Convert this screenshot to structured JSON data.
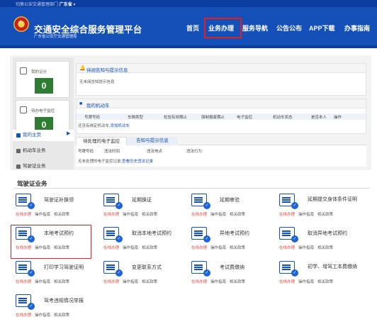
{
  "topbar": {
    "prefix": "切换公安交通管理部门",
    "region": "广东省",
    "arrow": "▾"
  },
  "header": {
    "title": "交通安全综合服务管理平台",
    "subtitle": "广东省公安厅交通管理局"
  },
  "nav": [
    "首页",
    "业务办理",
    "服务导航",
    "公告公布",
    "APP下载",
    "办事指南"
  ],
  "nav_highlight_index": 1,
  "sidebar": {
    "stats": [
      {
        "label": "我的记分",
        "value": "0"
      },
      {
        "label": "待办电子监控",
        "value": "0"
      }
    ],
    "menu": [
      {
        "label": "我的主页",
        "active": true
      },
      {
        "label": "机动车业务",
        "active": false
      },
      {
        "label": "驾驶证业务",
        "active": false
      }
    ]
  },
  "notice": {
    "title": "待阅告知与提示信息",
    "empty": "无未阅告知提示信息"
  },
  "vehicles": {
    "title": "我的机动车",
    "columns": [
      "号牌号码",
      "车辆类型",
      "检验有效期止",
      "强制报废期止",
      "电子监控",
      "机动车状态",
      "是否本人",
      "操作"
    ],
    "empty_prefix": "还没有绑定机动车,",
    "empty_link": "添加机动车"
  },
  "tabs": {
    "items": [
      "待处理的电子监控",
      "告知与提示信息"
    ],
    "active_index": 0
  },
  "monitor": {
    "columns": [
      "号牌号码",
      "违法时间",
      "违法地点",
      "违法行为"
    ],
    "empty_prefix": "无未处理的电子监控记录,",
    "empty_link": "查看历史违法记录"
  },
  "section": {
    "title": "驾驶证业务"
  },
  "links": {
    "online": "在线办理",
    "guide": "操作指南",
    "policy": "相关政策"
  },
  "services": [
    {
      "name": "驾驶证补换领",
      "icon": "license-card-icon"
    },
    {
      "name": "延期换证",
      "icon": "extend-license-icon"
    },
    {
      "name": "延期审验",
      "icon": "extend-review-icon"
    },
    {
      "name": "延期提交身体条件证明",
      "icon": "health-cert-icon"
    },
    {
      "name": "本地考试预约",
      "icon": "local-exam-icon"
    },
    {
      "name": "取消本地考试预约",
      "icon": "cancel-local-exam-icon"
    },
    {
      "name": "异地考试预约",
      "icon": "remote-exam-icon"
    },
    {
      "name": "取消异地考试预约",
      "icon": "cancel-remote-exam-icon"
    },
    {
      "name": "打印学习驾驶证明",
      "icon": "print-learner-icon"
    },
    {
      "name": "变更联系方式",
      "icon": "change-contact-icon"
    },
    {
      "name": "考试费缴纳",
      "icon": "exam-fee-icon"
    },
    {
      "name": "初学、增驾工本费缴纳",
      "icon": "fee-payment-icon"
    },
    {
      "name": "驾考违规情况举报",
      "icon": "report-icon"
    }
  ],
  "service_highlight_index": 4,
  "colors": {
    "header": "#1450b8",
    "topbar": "#0c3da0",
    "highlight": "#e02020",
    "online_link": "#e8453c",
    "stat_green": "#2e7d32"
  }
}
